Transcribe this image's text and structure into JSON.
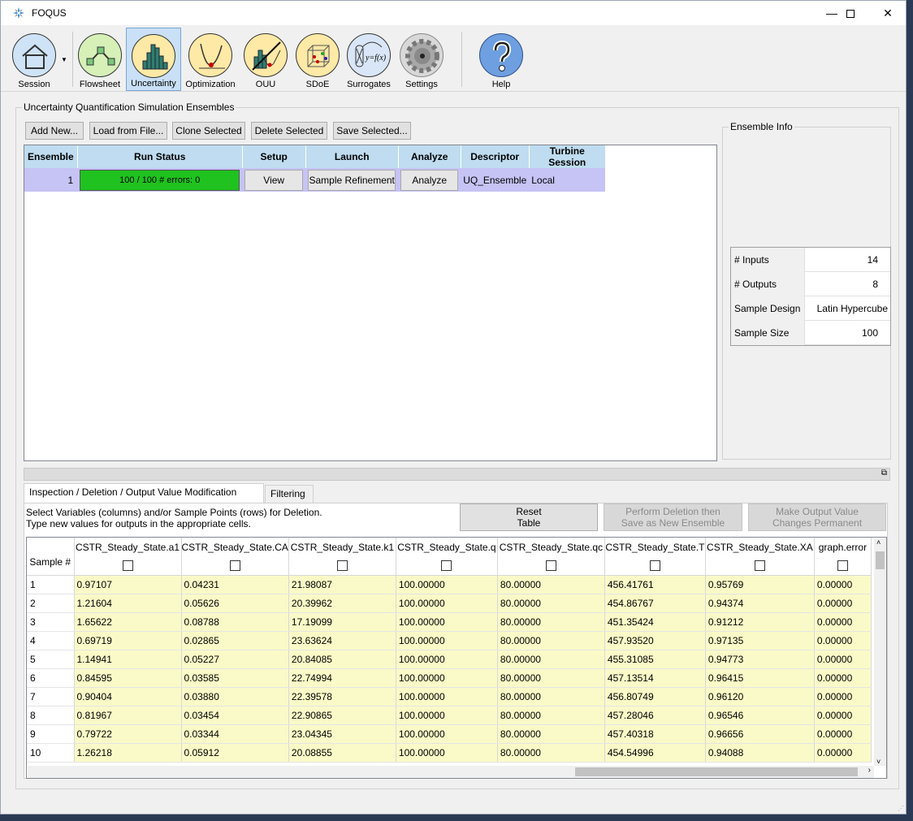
{
  "window": {
    "title": "FOQUS"
  },
  "toolbar": {
    "items": [
      {
        "label": "Session",
        "icon": "house-icon"
      },
      {
        "label": "Flowsheet",
        "icon": "flowsheet-icon"
      },
      {
        "label": "Uncertainty",
        "icon": "histogram-icon"
      },
      {
        "label": "Optimization",
        "icon": "optimization-curve-icon"
      },
      {
        "label": "OUU",
        "icon": "ouu-icon"
      },
      {
        "label": "SDoE",
        "icon": "cube-icon"
      },
      {
        "label": "Surrogates",
        "icon": "function-icon"
      },
      {
        "label": "Settings",
        "icon": "gear-icon"
      },
      {
        "label": "Help",
        "icon": "question-icon"
      }
    ],
    "active": "Uncertainty",
    "surrogates_formula": "y=f(x)"
  },
  "ensembles": {
    "group_title": "Uncertainty Quantification Simulation Ensembles",
    "buttons": {
      "add": "Add New...",
      "load": "Load from File...",
      "clone": "Clone Selected",
      "delete": "Delete Selected",
      "save": "Save Selected..."
    },
    "headers": [
      "Ensemble",
      "Run Status",
      "Setup",
      "Launch",
      "Analyze",
      "Descriptor",
      "Turbine Session"
    ],
    "rows": [
      {
        "ensemble": "1",
        "run_status": "100 / 100  # errors: 0",
        "progress": 1.0,
        "setup": "View",
        "launch": "Sample Refinement",
        "analyze": "Analyze",
        "descriptor": "UQ_Ensemble",
        "turbine_session": "Local"
      }
    ]
  },
  "ensemble_info": {
    "title": "Ensemble Info",
    "rows": [
      {
        "key": "# Inputs",
        "value": "14"
      },
      {
        "key": "# Outputs",
        "value": "8"
      },
      {
        "key": "Sample Design",
        "value": "Latin Hypercube"
      },
      {
        "key": "Sample Size",
        "value": "100"
      }
    ]
  },
  "inspection": {
    "tabs": [
      "Inspection / Deletion / Output Value Modification",
      "Filtering"
    ],
    "instructions_line1": "Select Variables (columns) and/or Sample Points (rows) for Deletion.",
    "instructions_line2": "Type new values for outputs in the appropriate cells.",
    "buttons": {
      "reset": "Reset\nTable",
      "perform_deletion": "Perform Deletion then\nSave as New Ensemble",
      "make_permanent": "Make Output Value\nChanges Permanent"
    },
    "row_header_label": "Sample #",
    "columns": [
      "CSTR_Steady_State.a1",
      "CSTR_Steady_State.CA",
      "CSTR_Steady_State.k1",
      "CSTR_Steady_State.q",
      "CSTR_Steady_State.qc",
      "CSTR_Steady_State.T",
      "CSTR_Steady_State.XA",
      "graph.error"
    ],
    "rows": [
      [
        "1",
        "0.97107",
        "0.04231",
        "21.98087",
        "100.00000",
        "80.00000",
        "456.41761",
        "0.95769",
        "0.00000"
      ],
      [
        "2",
        "1.21604",
        "0.05626",
        "20.39962",
        "100.00000",
        "80.00000",
        "454.86767",
        "0.94374",
        "0.00000"
      ],
      [
        "3",
        "1.65622",
        "0.08788",
        "17.19099",
        "100.00000",
        "80.00000",
        "451.35424",
        "0.91212",
        "0.00000"
      ],
      [
        "4",
        "0.69719",
        "0.02865",
        "23.63624",
        "100.00000",
        "80.00000",
        "457.93520",
        "0.97135",
        "0.00000"
      ],
      [
        "5",
        "1.14941",
        "0.05227",
        "20.84085",
        "100.00000",
        "80.00000",
        "455.31085",
        "0.94773",
        "0.00000"
      ],
      [
        "6",
        "0.84595",
        "0.03585",
        "22.74994",
        "100.00000",
        "80.00000",
        "457.13514",
        "0.96415",
        "0.00000"
      ],
      [
        "7",
        "0.90404",
        "0.03880",
        "22.39578",
        "100.00000",
        "80.00000",
        "456.80749",
        "0.96120",
        "0.00000"
      ],
      [
        "8",
        "0.81967",
        "0.03454",
        "22.90865",
        "100.00000",
        "80.00000",
        "457.28046",
        "0.96546",
        "0.00000"
      ],
      [
        "9",
        "0.79722",
        "0.03344",
        "23.04345",
        "100.00000",
        "80.00000",
        "457.40318",
        "0.96656",
        "0.00000"
      ],
      [
        "10",
        "1.26218",
        "0.05912",
        "20.08855",
        "100.00000",
        "80.00000",
        "454.54996",
        "0.94088",
        "0.00000"
      ]
    ]
  }
}
